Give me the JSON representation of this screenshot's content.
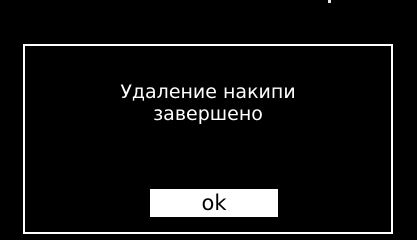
{
  "dialog": {
    "message_line1": "Удаление накипи",
    "message_line2": "завершено",
    "ok_label": "ok"
  },
  "colors": {
    "background": "#000000",
    "foreground": "#ffffff"
  }
}
